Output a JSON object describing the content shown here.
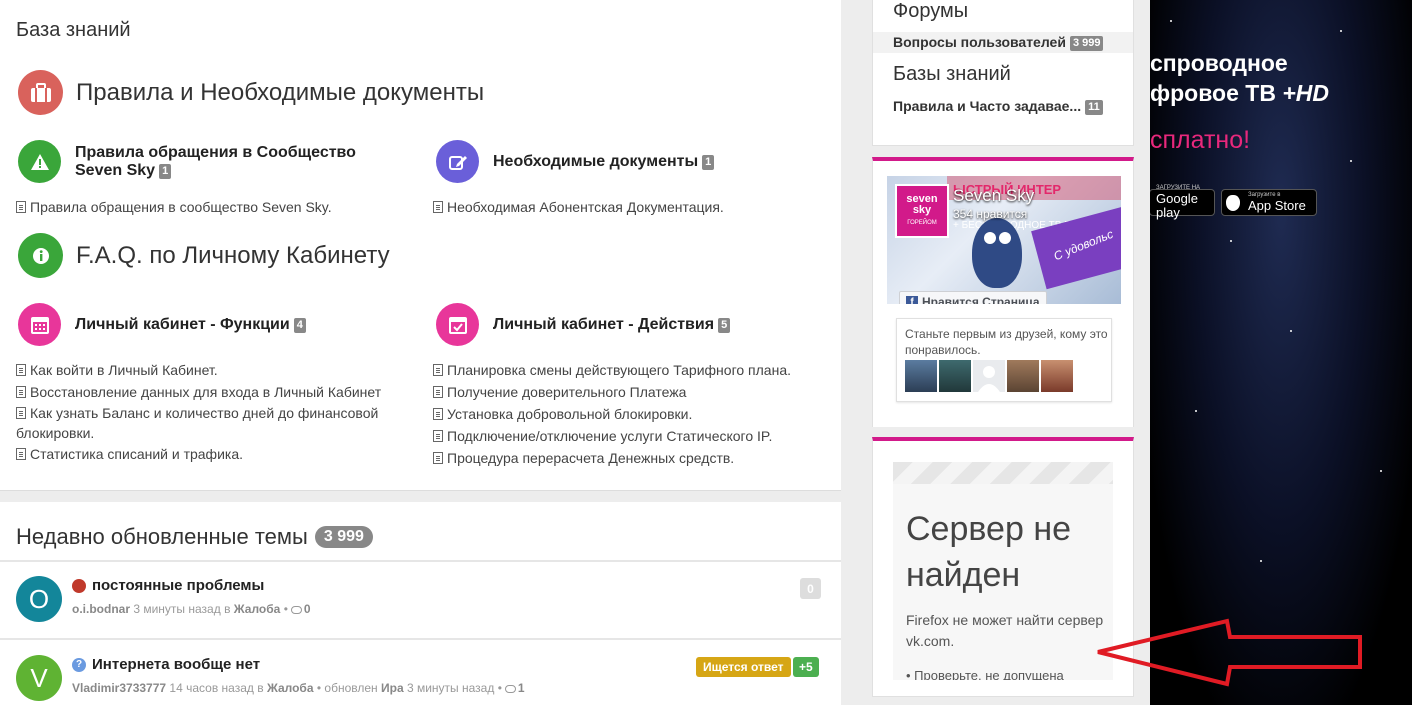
{
  "knowledge_base": {
    "title": "База знаний",
    "sections": [
      {
        "title": "Правила и Необходимые документы",
        "icon": "briefcase-icon",
        "categories": [
          {
            "label_line1": "Правила обращения в Сообщество",
            "label_line2": "Seven Sky",
            "count": "1",
            "icon": "warning-icon",
            "links": [
              "Правила обращения в сообщество Seven Sky."
            ]
          },
          {
            "label": "Необходимые документы",
            "count": "1",
            "icon": "edit-icon",
            "links": [
              "Необходимая Абонентская Документация."
            ]
          }
        ]
      },
      {
        "title": "F.A.Q. по Личному Кабинету",
        "icon": "info-icon",
        "categories": [
          {
            "label": "Личный кабинет - Функции",
            "count": "4",
            "icon": "calendar-icon",
            "links": [
              "Как войти в Личный Кабинет.",
              "Восстановление данных для входа в Личный Кабинет",
              "Как узнать Баланс и количество дней до финансовой блокировки.",
              "Статистика списаний и трафика."
            ]
          },
          {
            "label": "Личный кабинет - Действия",
            "count": "5",
            "icon": "calendar-check-icon",
            "links": [
              "Планировка смены действующего Тарифного плана.",
              "Получение доверительного Платежа",
              "Установка добровольной блокировки.",
              "Подключение/отключение услуги Статического IP.",
              "Процедура перерасчета Денежных средств."
            ]
          }
        ]
      }
    ]
  },
  "recent": {
    "title": "Недавно обновленные темы",
    "count": "3 999",
    "topics": [
      {
        "avatar_letter": "O",
        "avatar_color": "#13869a",
        "icon": "bug-icon",
        "title": "постоянные проблемы",
        "author": "o.i.bodnar",
        "time": "3 минуты назад",
        "in": "в",
        "forum": "Жалоба",
        "sep": "•",
        "comments": "0",
        "badge": "0"
      },
      {
        "avatar_letter": "V",
        "avatar_color": "#5fb333",
        "icon": "question-icon",
        "title": "Интернета вообще нет",
        "author": "Vladimir3733777",
        "time": "14 часов назад",
        "in": "в",
        "forum": "Жалоба",
        "sep": "•",
        "updated": "обновлен",
        "updater": "Ира",
        "updated_time": "3 минуты назад",
        "comments": "1",
        "status": "Ищется ответ",
        "votes": "+5"
      }
    ]
  },
  "sidebar": {
    "forums_title": "Форумы",
    "forums_item": "Вопросы пользователей",
    "forums_count": "3 999",
    "kb_title": "Базы знаний",
    "kb_item": "Правила и Часто задавае...",
    "kb_count": "11",
    "accent": "#d21a8a"
  },
  "fb_widget": {
    "logo_line1": "seven",
    "logo_line2": "sky",
    "logo_line3": "ГОРЕЙОМ",
    "page_name": "Seven Sky",
    "likes": "354 нравится",
    "like_button": "Нравится Страница",
    "friends_text": "Станьте первым из друзей, кому это понравилось.",
    "cover_banner": "ЫСТРЫЙ ИНТЕР",
    "cover_banner2": "+ БЕСПРОВОДНОЕ ТВ БЕСПЛА",
    "ribbon_text": "С удовольс"
  },
  "error_frame": {
    "title": "Сервер не найден",
    "text": "Firefox не может найти сервер vk.com.",
    "bullet": "•  Проверьте, не допущена"
  },
  "ad": {
    "line1": "спроводное",
    "line2a": "фровое ТВ ",
    "line2b": "+HD",
    "line3": "сплатно!",
    "store1_small": "ЗАГРУЗИТЕ НА",
    "store1": "Google play",
    "store2_small": "Загрузите в",
    "store2": "App Store"
  }
}
